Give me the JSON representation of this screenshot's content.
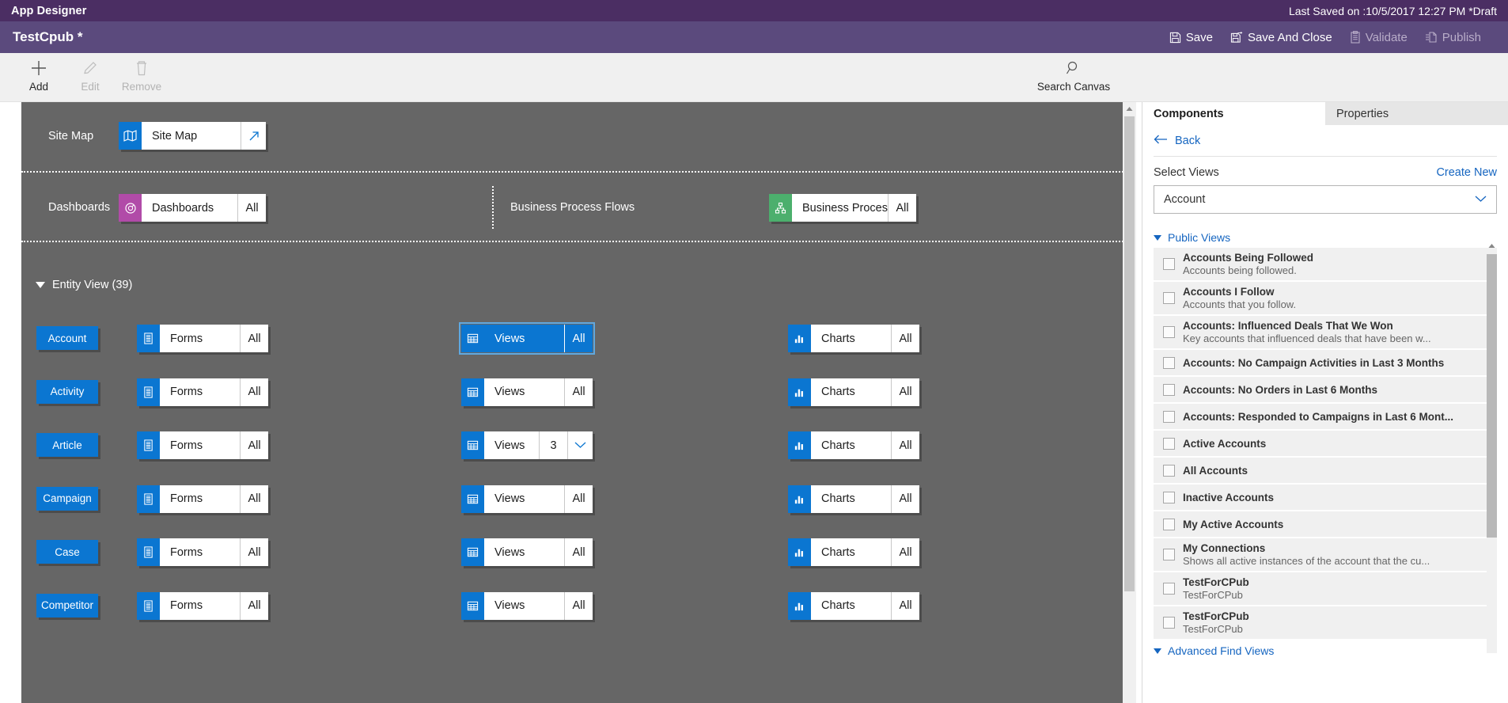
{
  "titlebar": {
    "app_title": "App Designer",
    "last_saved": "Last Saved on :10/5/2017 12:27 PM *Draft"
  },
  "commandbar": {
    "doc_title": "TestCpub *",
    "actions": [
      {
        "label": "Save",
        "icon": "save-icon",
        "enabled": true
      },
      {
        "label": "Save And Close",
        "icon": "save-and-close-icon",
        "enabled": true
      },
      {
        "label": "Validate",
        "icon": "validate-icon",
        "enabled": false
      },
      {
        "label": "Publish",
        "icon": "publish-icon",
        "enabled": false
      }
    ]
  },
  "ribbon": {
    "add_label": "Add",
    "edit_label": "Edit",
    "remove_label": "Remove",
    "search_label": "Search Canvas"
  },
  "canvas": {
    "sitemap_row": {
      "label": "Site Map",
      "tile": {
        "name": "Site Map",
        "icon": "map-icon",
        "icon_color": "#0b76d1",
        "arrow": "open-arrow-icon"
      }
    },
    "dashboards_row": {
      "label": "Dashboards",
      "tile": {
        "name": "Dashboards",
        "count": "All",
        "icon": "dashboard-icon",
        "icon_color": "#b14ba8"
      }
    },
    "bpf_row": {
      "label": "Business Process Flows",
      "tile": {
        "name": "Business Proces...",
        "count": "All",
        "icon": "process-flow-icon",
        "icon_color": "#4caf6d"
      }
    },
    "entity_section": {
      "label": "Entity View (39)",
      "column_labels": {
        "forms": "Forms",
        "views": "Views",
        "charts": "Charts"
      },
      "entities": [
        {
          "name": "Account",
          "forms": {
            "label": "Forms",
            "count": "All"
          },
          "views": {
            "label": "Views",
            "count": "All",
            "selected": true
          },
          "charts": {
            "label": "Charts",
            "count": "All"
          }
        },
        {
          "name": "Activity",
          "forms": {
            "label": "Forms",
            "count": "All"
          },
          "views": {
            "label": "Views",
            "count": "All",
            "selected": false
          },
          "charts": {
            "label": "Charts",
            "count": "All"
          }
        },
        {
          "name": "Article",
          "forms": {
            "label": "Forms",
            "count": "All"
          },
          "views": {
            "label": "Views",
            "count": "3",
            "selected": false,
            "dropdown": true
          },
          "charts": {
            "label": "Charts",
            "count": "All"
          }
        },
        {
          "name": "Campaign",
          "forms": {
            "label": "Forms",
            "count": "All"
          },
          "views": {
            "label": "Views",
            "count": "All",
            "selected": false
          },
          "charts": {
            "label": "Charts",
            "count": "All"
          }
        },
        {
          "name": "Case",
          "forms": {
            "label": "Forms",
            "count": "All"
          },
          "views": {
            "label": "Views",
            "count": "All",
            "selected": false
          },
          "charts": {
            "label": "Charts",
            "count": "All"
          }
        },
        {
          "name": "Competitor",
          "forms": {
            "label": "Forms",
            "count": "All"
          },
          "views": {
            "label": "Views",
            "count": "All",
            "selected": false
          },
          "charts": {
            "label": "Charts",
            "count": "All"
          }
        }
      ]
    }
  },
  "right_panel": {
    "tabs": [
      {
        "label": "Components",
        "active": true
      },
      {
        "label": "Properties",
        "active": false
      }
    ],
    "back_label": "Back",
    "select_views_label": "Select Views",
    "create_new_label": "Create New",
    "entity_combo_value": "Account",
    "groups": [
      {
        "label": "Public Views",
        "items": [
          {
            "title": "Accounts Being Followed",
            "desc": "Accounts being followed.",
            "checked": false
          },
          {
            "title": "Accounts I Follow",
            "desc": "Accounts that you follow.",
            "checked": false
          },
          {
            "title": "Accounts: Influenced Deals That We Won",
            "desc": "Key accounts that influenced deals that have been w...",
            "checked": false
          },
          {
            "title": "Accounts: No Campaign Activities in Last 3 Months",
            "desc": "",
            "checked": false
          },
          {
            "title": "Accounts: No Orders in Last 6 Months",
            "desc": "",
            "checked": false
          },
          {
            "title": "Accounts: Responded to Campaigns in Last 6 Mont...",
            "desc": "",
            "checked": false
          },
          {
            "title": "Active Accounts",
            "desc": "",
            "checked": false
          },
          {
            "title": "All Accounts",
            "desc": "",
            "checked": false
          },
          {
            "title": "Inactive Accounts",
            "desc": "",
            "checked": false
          },
          {
            "title": "My Active Accounts",
            "desc": "",
            "checked": false
          },
          {
            "title": "My Connections",
            "desc": "Shows all active instances of the account that the cu...",
            "checked": false
          },
          {
            "title": "TestForCPub",
            "desc": "TestForCPub",
            "checked": false
          },
          {
            "title": "TestForCPub",
            "desc": "TestForCPub",
            "checked": false
          }
        ]
      },
      {
        "label": "Advanced Find Views",
        "items": []
      }
    ]
  },
  "colors": {
    "titlebar": "#4b2e63",
    "commandbar": "#5b4a7d",
    "accent_blue": "#0b76d1",
    "canvas_gray": "#666666",
    "dashboard_purple": "#b14ba8",
    "bpf_green": "#4caf6d"
  }
}
